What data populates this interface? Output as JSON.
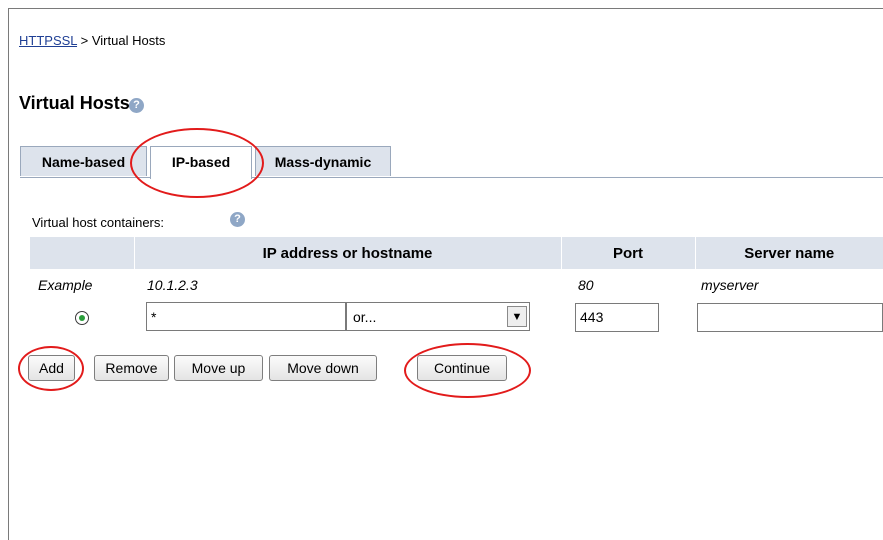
{
  "breadcrumb": {
    "link": "HTTPSSL",
    "separator": " > ",
    "current": "Virtual Hosts"
  },
  "page": {
    "title": "Virtual Hosts",
    "help_glyph": "?"
  },
  "tabs": [
    {
      "label": "Name-based",
      "active": false
    },
    {
      "label": "IP-based",
      "active": true
    },
    {
      "label": "Mass-dynamic",
      "active": false
    }
  ],
  "containers": {
    "label": "Virtual host containers:",
    "help_glyph": "?"
  },
  "table": {
    "headers": [
      "",
      "IP address or hostname",
      "Port",
      "Server name"
    ],
    "example": {
      "label": "Example",
      "ip": "10.1.2.3",
      "port": "80",
      "server": "myserver"
    },
    "row": {
      "selected": true,
      "ip_value": "*",
      "ip_select": "or...",
      "port_value": "443",
      "server_value": ""
    }
  },
  "buttons": {
    "add": "Add",
    "remove": "Remove",
    "move_up": "Move up",
    "move_down": "Move down",
    "continue": "Continue"
  },
  "colors": {
    "callout": "#e21b1b",
    "link": "#1f3f94",
    "tab_bg": "#dde3ec"
  }
}
